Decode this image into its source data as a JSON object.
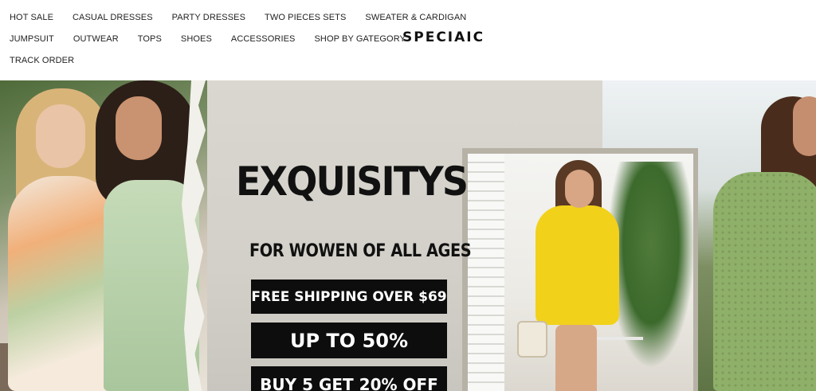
{
  "header": {
    "nav_row1": [
      "HOT SALE",
      "CASUAL DRESSES",
      "PARTY DRESSES",
      "TWO PIECES SETS",
      "SWEATER & CARDIGAN"
    ],
    "nav_row2": [
      "JUMPSUIT",
      "OUTWEAR",
      "TOPS",
      "SHOES",
      "ACCESSORIES",
      "SHOP BY GATEGORY"
    ],
    "nav_row3": [
      "TRACK ORDER"
    ],
    "logo": "SPECIAIC"
  },
  "banner": {
    "headline": "EXQUISITYS",
    "subheadline": "FOR WOWEN OF ALL AGES",
    "promo1": "FREE SHIPPING OVER $69",
    "promo2": "UP TO 50%",
    "promo3": "BUY 5 GET 20% OFF"
  }
}
